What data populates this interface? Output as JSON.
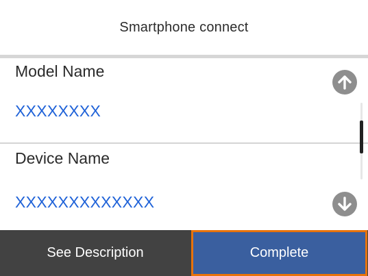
{
  "screen": {
    "title": "Smartphone connect"
  },
  "fields": [
    {
      "label": "Model Name",
      "value": "XXXXXXXX"
    },
    {
      "label": "Device Name",
      "value": "XXXXXXXXXXXXX"
    }
  ],
  "icons": {
    "scroll_up": "arrow-up-circle-icon",
    "scroll_down": "arrow-down-circle-icon"
  },
  "buttons": {
    "see_description": "See Description",
    "complete": "Complete"
  },
  "colors": {
    "value_text": "#1f62d8",
    "bottom_bar": "#424242",
    "complete_button": "#3a5f9f",
    "selection_border": "#e8730c",
    "scroll_button": "#8e8e8e"
  }
}
